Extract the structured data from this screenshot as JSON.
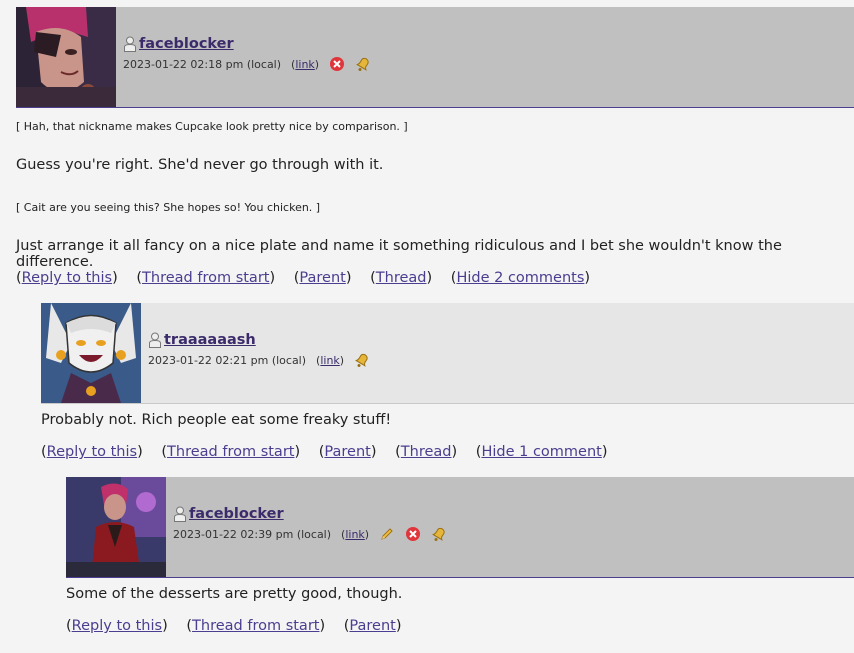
{
  "comments": [
    {
      "username": "faceblocker",
      "datetime": "2023-01-22 02:18 pm (local)",
      "link_label": "link",
      "header_bg": "#c0c0c0",
      "quote1": "[ Hah, that nickname makes Cupcake look pretty nice by comparison. ]",
      "text1": "Guess you're right. She'd never go through with it.",
      "quote2": "[ Cait are you seeing this? She hopes so! You chicken. ]",
      "text2": "Just arrange it all fancy on a nice plate and name it something ridiculous and I bet she wouldn't know the difference.",
      "actions": [
        "Reply to this",
        "Thread from start",
        "Parent",
        "Thread",
        "Hide 2 comments"
      ],
      "icons": [
        "delete-icon",
        "track-bell-icon"
      ]
    },
    {
      "username": "traaaaaash",
      "datetime": "2023-01-22 02:21 pm (local)",
      "link_label": "link",
      "header_bg": "#e6e6e6",
      "text1": "Probably not. Rich people eat some freaky stuff!",
      "actions": [
        "Reply to this",
        "Thread from start",
        "Parent",
        "Thread",
        "Hide 1 comment"
      ],
      "icons": [
        "track-bell-icon"
      ]
    },
    {
      "username": "faceblocker",
      "datetime": "2023-01-22 02:39 pm (local)",
      "link_label": "link",
      "header_bg": "#c0c0c0",
      "text1": "Some of the desserts are pretty good, though.",
      "actions": [
        "Reply to this",
        "Thread from start",
        "Parent"
      ],
      "icons": [
        "edit-icon",
        "delete-icon",
        "track-bell-icon"
      ]
    }
  ]
}
